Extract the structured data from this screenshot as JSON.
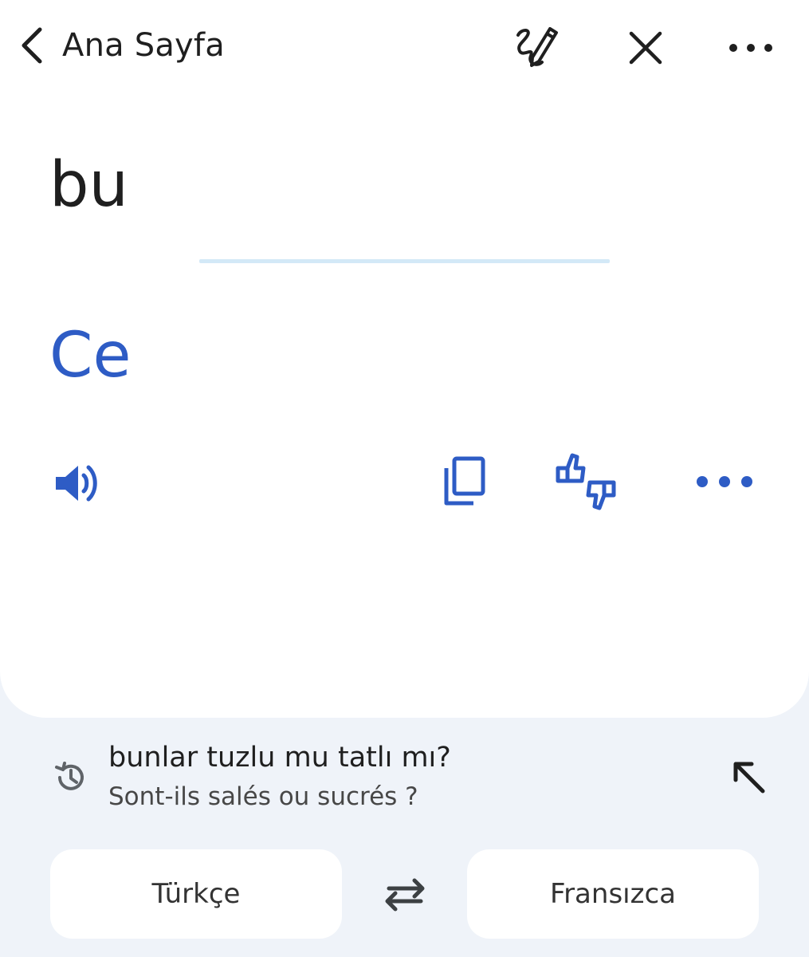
{
  "top_bar": {
    "back_label": "Ana Sayfa",
    "icons": [
      "chevron-left-icon",
      "handwriting-icon",
      "close-icon",
      "more-horiz-icon"
    ]
  },
  "translation": {
    "source_text": "bu",
    "translated_text": "Ce",
    "action_icons": [
      "speaker-icon",
      "copy-icon",
      "feedback-icon",
      "more-horiz-icon"
    ]
  },
  "history": {
    "source": "bunlar tuzlu mu tatlı mı?",
    "translation": "Sont-ils salés ou sucrés ?",
    "icons": [
      "history-icon",
      "arrow-up-left-icon"
    ]
  },
  "languages": {
    "source": "Türkçe",
    "target": "Fransızca",
    "swap_icon": "swap-icon"
  },
  "colors": {
    "accent": "#2E5CC5",
    "background": "#EFF3F9",
    "card": "#FFFFFF",
    "divider": "#D3E9F7",
    "text": "#1F1F1F"
  }
}
